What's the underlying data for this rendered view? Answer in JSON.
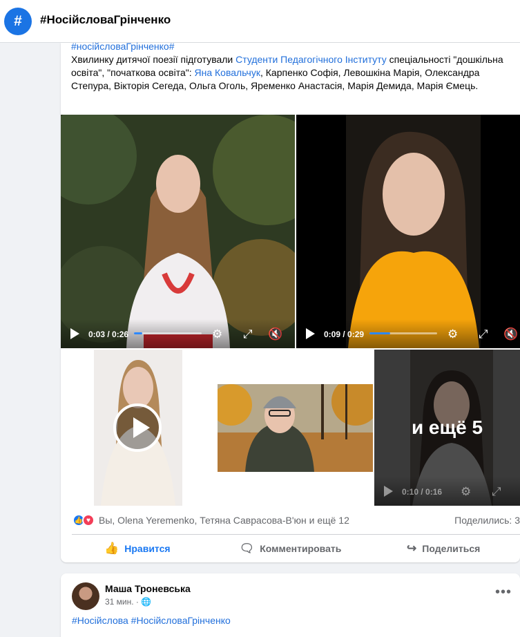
{
  "header": {
    "icon": "#",
    "title": "#НосійсловаГрінченко"
  },
  "post": {
    "hashtag": "#носійсловаГрінченко",
    "hashtag_suffix": "#",
    "text_before_link": "Хвилинку дитячої поезії підготували ",
    "link1": "Студенти Педагогічного Інституту",
    "text_mid": " спеціальності \"дошкільна освіта\", \"початкова освіта\": ",
    "link2": "Яна Ковальчук",
    "text_after": ", Карпенко Софія, Левошкіна Марія, Олександра Степура, Вікторія Сегеда, Ольга Оголь, Яременко Анастасія, Марія Демида, Марія Ємець.",
    "videos": [
      {
        "time": "0:03 / 0:26",
        "progress": 0.12
      },
      {
        "time": "0:09 / 0:29",
        "progress": 0.31
      },
      {
        "time": "0:10 / 0:16",
        "progress": 0.62
      }
    ],
    "more_label": "и ещё 5",
    "reactions_text": "Вы, Olena Yeremenko, Тетяна Саврасова-В'юн и ещё 12",
    "shares_text": "Поделились: 3",
    "actions": {
      "like": "Нравится",
      "comment": "Комментировать",
      "share": "Поделиться"
    },
    "colors": {
      "link": "#216fdb",
      "like_active": "#1877f2",
      "progress": "#2d88ff"
    }
  },
  "post2": {
    "author": "Маша Троневська",
    "meta": "31 мин. ·",
    "tags": "#Носійслова #НосійсловаГрінченко"
  }
}
